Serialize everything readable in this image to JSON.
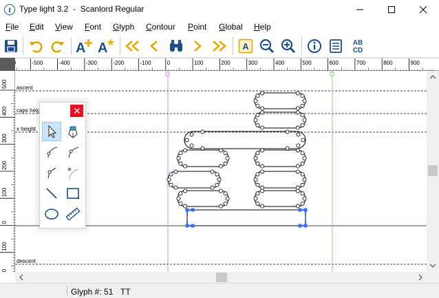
{
  "window": {
    "title": "Type light 3.2  -  Scanlord Regular"
  },
  "menu": [
    "File",
    "Edit",
    "View",
    "Font",
    "Glyph",
    "Contour",
    "Point",
    "Global",
    "Help"
  ],
  "toolbar": {
    "icons": [
      "save-icon",
      "undo-icon",
      "redo-icon",
      "add-glyph-icon",
      "add-glyph-star-icon",
      "first-glyph-icon",
      "previous-glyph-icon",
      "find-glyph-icon",
      "next-glyph-icon",
      "last-glyph-icon",
      "glyph-view-icon",
      "zoom-out-icon",
      "zoom-in-icon",
      "info-icon",
      "list-icon",
      "charset-icon"
    ],
    "charset_label_top": "AB",
    "charset_label_bottom": "CD",
    "glyph_button_label": "A"
  },
  "ruler": {
    "top_ticks": [
      "-600",
      "-500",
      "-400",
      "-300",
      "-200",
      "-100",
      "0",
      "100",
      "200",
      "300",
      "400",
      "500",
      "600",
      "700",
      "800",
      "900"
    ],
    "left_ticks": [
      "500",
      "400",
      "300",
      "200",
      "100",
      "0",
      "100",
      "200"
    ]
  },
  "guides": {
    "ascent": "ascent",
    "caps_height": "caps height",
    "x_height": "x height",
    "descent": "descent"
  },
  "status": {
    "glyph_label": "Glyph #: 51",
    "glyph_name": "TT"
  },
  "colors": {
    "accent": "#1c4e8a",
    "selection": "#3b6cf0",
    "left_metric_line": "#e58ad8",
    "right_metric_line": "#7fd47f",
    "close_red": "#e81123"
  }
}
